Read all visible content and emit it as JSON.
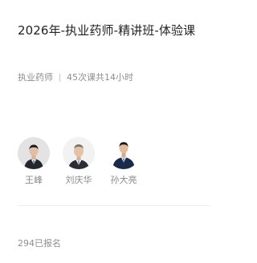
{
  "course": {
    "title": "2026年-执业药师-精讲班-体验课",
    "category": "执业药师",
    "lesson_info": "45次课共14小时",
    "enrolled": "294已报名"
  },
  "teachers": [
    {
      "name": "王峰",
      "avatar_icon": "teacher-portrait-icon"
    },
    {
      "name": "刘庆华",
      "avatar_icon": "teacher-portrait-icon"
    },
    {
      "name": "孙大亮",
      "avatar_icon": "teacher-portrait-icon"
    }
  ],
  "colors": {
    "title": "#222222",
    "secondary_text": "#8e8e8e",
    "divider": "#eeeeee",
    "background": "#ffffff"
  }
}
